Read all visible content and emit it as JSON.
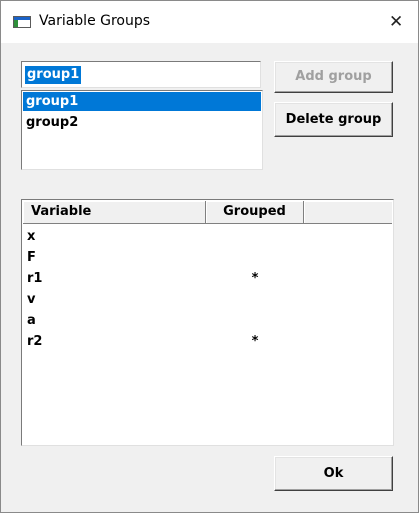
{
  "window": {
    "title": "Variable Groups",
    "close_glyph": "✕"
  },
  "group_name_input": {
    "value": "group1"
  },
  "groups": {
    "items": [
      {
        "label": "group1",
        "selected": true
      },
      {
        "label": "group2",
        "selected": false
      }
    ]
  },
  "buttons": {
    "add_group": "Add group",
    "delete_group": "Delete group",
    "ok": "Ok"
  },
  "variables_table": {
    "headers": [
      "Variable",
      "Grouped",
      ""
    ],
    "rows": [
      {
        "variable": "x",
        "grouped": ""
      },
      {
        "variable": "F",
        "grouped": ""
      },
      {
        "variable": "r1",
        "grouped": "*"
      },
      {
        "variable": "v",
        "grouped": ""
      },
      {
        "variable": "a",
        "grouped": ""
      },
      {
        "variable": "r2",
        "grouped": "*"
      }
    ]
  },
  "colors": {
    "selection": "#0078d7",
    "dialog_bg": "#f0f0f0",
    "disabled_text": "#a0a0a0"
  },
  "icons": {
    "app": "app-window-icon",
    "close": "close-icon"
  }
}
